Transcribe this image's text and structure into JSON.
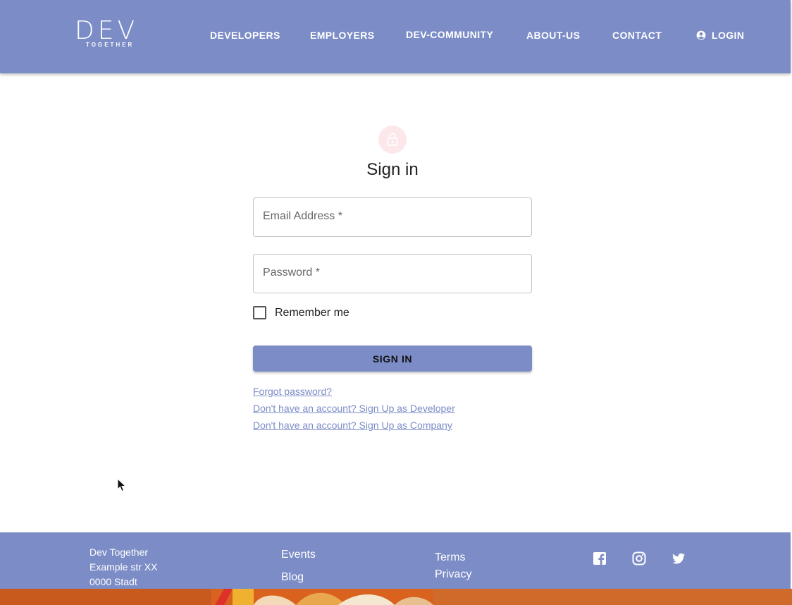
{
  "header": {
    "logo_main": "DEV",
    "logo_sub": "TOGETHER",
    "nav": [
      "DEVELOPERS",
      "EMPLOYERS",
      "DEV-COMMUNITY",
      "ABOUT-US",
      "CONTACT"
    ],
    "login_label": "LOGIN"
  },
  "signin": {
    "title": "Sign in",
    "email_label": "Email Address *",
    "email_value": "",
    "password_label": "Password *",
    "password_value": "",
    "remember_label": "Remember me",
    "remember_checked": false,
    "button_label": "SIGN IN",
    "forgot_link": "Forgot password?",
    "signup_developer_link": "Don't have an account? Sign Up as Developer",
    "signup_company_link": "Don't have an account? Sign Up as Company"
  },
  "footer": {
    "address": [
      "Dev Together",
      "Example str XX",
      "0000 Stadt"
    ],
    "links_col1": [
      "Events",
      "Blog"
    ],
    "links_col2": [
      "Terms",
      "Privacy"
    ],
    "social": [
      "facebook-icon",
      "instagram-icon",
      "twitter-icon"
    ]
  },
  "colors": {
    "brand": "#7b8cc6",
    "avatar_bg": "#fce8ea",
    "banner": "#d9631e"
  }
}
